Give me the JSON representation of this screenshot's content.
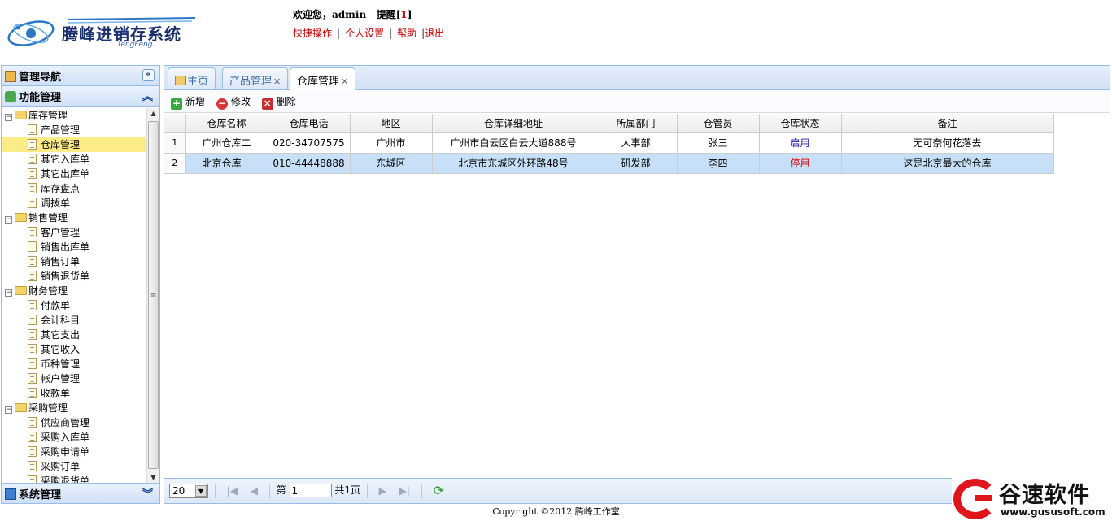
{
  "header": {
    "logo_title": "腾峰进销存系统",
    "logo_sub": "TengFeng",
    "welcome_prefix": "欢迎您，",
    "user": "admin",
    "remind_label": "提醒[",
    "remind_count": "1",
    "remind_close": "]",
    "links": [
      "快捷操作",
      "个人设置",
      "帮助",
      "退出"
    ]
  },
  "sidebar": {
    "nav_title": "管理导航",
    "func_title": "功能管理",
    "sys_title": "系统管理",
    "groups": [
      {
        "label": "库存管理",
        "items": [
          "产品管理",
          "仓库管理",
          "其它入库单",
          "其它出库单",
          "库存盘点",
          "调拨单"
        ]
      },
      {
        "label": "销售管理",
        "items": [
          "客户管理",
          "销售出库单",
          "销售订单",
          "销售退货单"
        ]
      },
      {
        "label": "财务管理",
        "items": [
          "付款单",
          "会计科目",
          "其它支出",
          "其它收入",
          "币种管理",
          "帐户管理",
          "收款单"
        ]
      },
      {
        "label": "采购管理",
        "items": [
          "供应商管理",
          "采购入库单",
          "采购申请单",
          "采购订单",
          "采购退货单"
        ]
      }
    ],
    "selected_item": "仓库管理"
  },
  "tabs": [
    {
      "label": "主页",
      "closable": false
    },
    {
      "label": "产品管理",
      "closable": true
    },
    {
      "label": "仓库管理",
      "closable": true,
      "active": true
    }
  ],
  "toolbar": {
    "add": "新增",
    "edit": "修改",
    "delete": "删除"
  },
  "grid": {
    "columns": [
      "仓库名称",
      "仓库电话",
      "地区",
      "仓库详细地址",
      "所属部门",
      "仓管员",
      "仓库状态",
      "备注"
    ],
    "rows": [
      {
        "no": "1",
        "cells": [
          "广州仓库二",
          "020-34707575",
          "广州市",
          "广州市白云区白云大道888号",
          "人事部",
          "张三",
          "启用",
          "无可奈何花落去"
        ],
        "status": "on"
      },
      {
        "no": "2",
        "cells": [
          "北京仓库一",
          "010-44448888",
          "东城区",
          "北京市东城区外环路48号",
          "研发部",
          "李四",
          "停用",
          "这是北京最大的仓库"
        ],
        "status": "off",
        "selected": true
      }
    ]
  },
  "pager": {
    "page_size": "20",
    "page_label_prefix": "第",
    "page_value": "1",
    "page_total": "共1页"
  },
  "footer": "Copyright ©2012 腾峰工作室",
  "watermark": {
    "text": "谷速软件",
    "url": "www.gususoft.com"
  },
  "colors": {
    "accent": "#99bbe8",
    "status_on": "#1a1aa8",
    "status_off": "#d40000",
    "link": "#cc0000"
  }
}
